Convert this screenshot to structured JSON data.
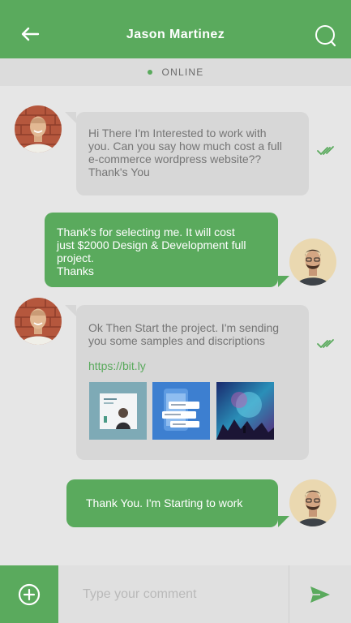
{
  "header": {
    "title": "Jason Martinez",
    "back_icon": "arrow-left-icon",
    "search_icon": "search-icon"
  },
  "status": {
    "text": "ONLINE"
  },
  "messages": [
    {
      "direction": "incoming",
      "lines": [
        "Hi There I'm Interested to work with",
        "you. Can you say how much cost a full",
        "e-commerce wordpress website??",
        "Thank's You"
      ],
      "read": true
    },
    {
      "direction": "outgoing",
      "lines": [
        "Thank's for selecting me. It will cost",
        "just  $2000 Design & Development full",
        "project.",
        "Thanks"
      ]
    },
    {
      "direction": "incoming",
      "lines": [
        "Ok Then Start the project. I'm sending",
        "you some samples and discriptions"
      ],
      "link": "https://bit.ly",
      "attachments": [
        "sample-1",
        "sample-2",
        "sample-3"
      ],
      "read": true
    },
    {
      "direction": "outgoing",
      "lines": [
        "Thank You. I'm Starting to work"
      ]
    }
  ],
  "composer": {
    "placeholder": "Type your comment",
    "add_icon": "plus-circle-icon",
    "send_icon": "send-icon"
  },
  "colors": {
    "accent": "#5aaa5d",
    "incoming_bubble": "#d7d7d7",
    "background": "#e6e6e6"
  }
}
